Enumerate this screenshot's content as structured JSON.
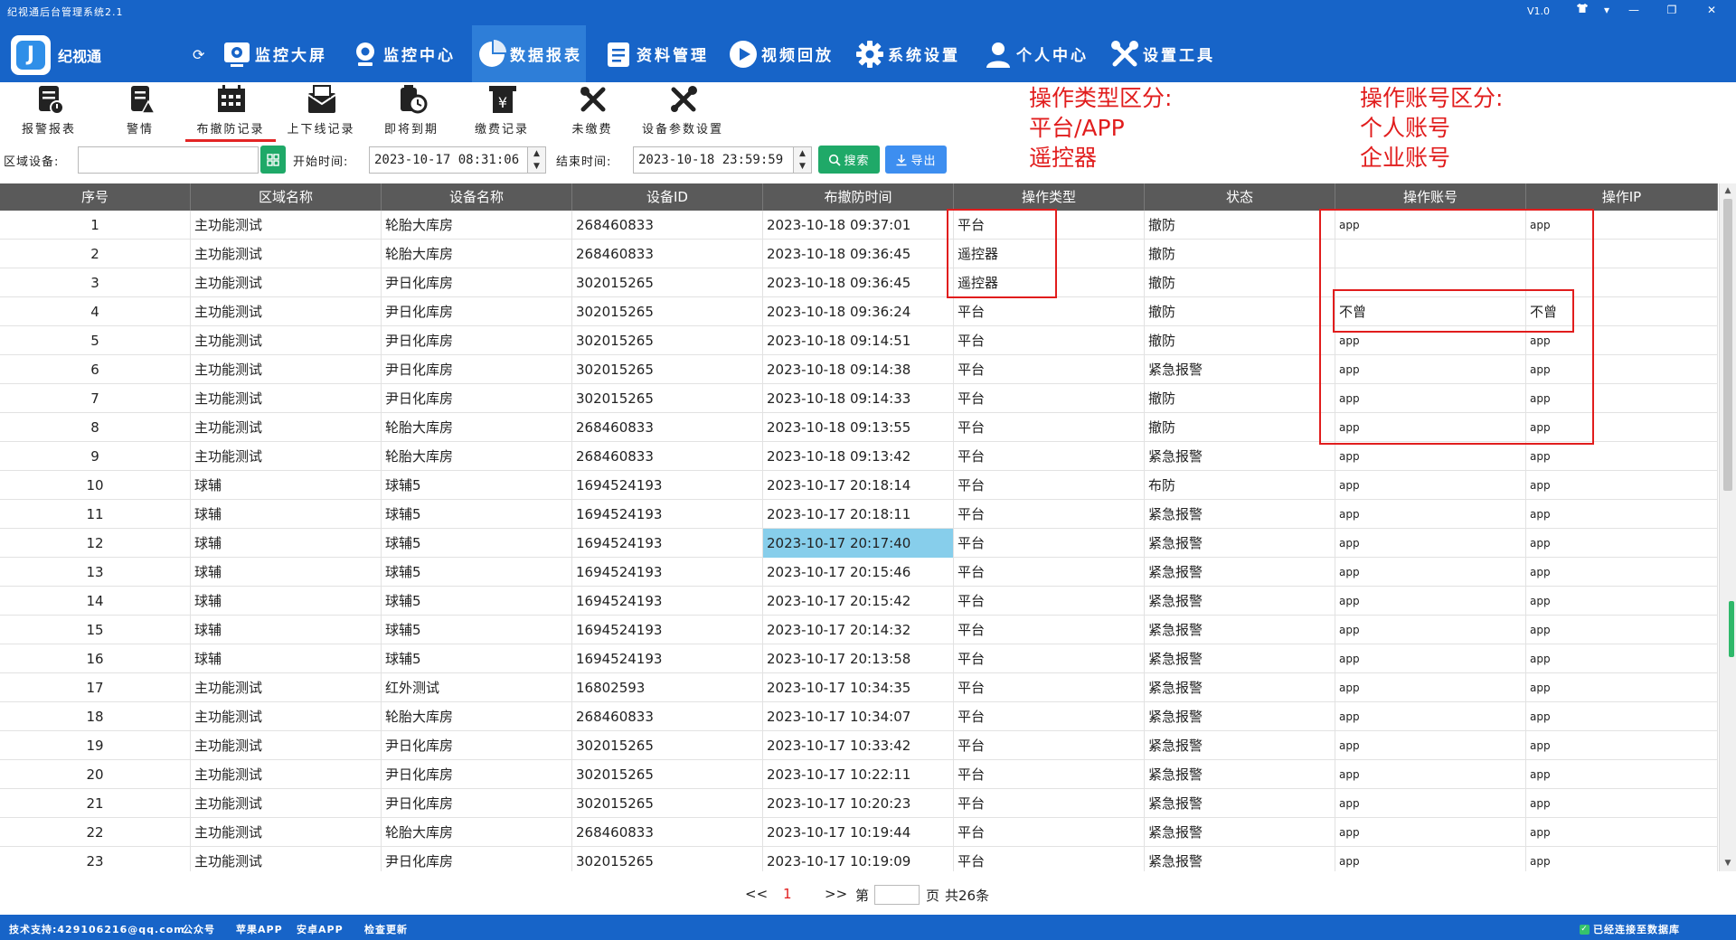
{
  "window": {
    "title": "纪视通后台管理系统2.1",
    "version": "V1.0"
  },
  "brand": {
    "logo_text": "纪视通"
  },
  "nav": {
    "items": [
      {
        "label": "监控大屏",
        "icon": "monitor-icon"
      },
      {
        "label": "监控中心",
        "icon": "camera-icon"
      },
      {
        "label": "数据报表",
        "icon": "pie-chart-icon"
      },
      {
        "label": "资料管理",
        "icon": "document-icon"
      },
      {
        "label": "视频回放",
        "icon": "play-icon"
      },
      {
        "label": "系统设置",
        "icon": "gear-icon"
      },
      {
        "label": "个人中心",
        "icon": "user-icon"
      },
      {
        "label": "设置工具",
        "icon": "tools-icon"
      }
    ],
    "active": "数据报表"
  },
  "toolbar": {
    "items": [
      {
        "label": "报警报表",
        "icon": "alarm-report-icon"
      },
      {
        "label": "警情",
        "icon": "alert-doc-icon"
      },
      {
        "label": "布撤防记录",
        "icon": "calendar-icon"
      },
      {
        "label": "上下线记录",
        "icon": "envelope-icon"
      },
      {
        "label": "即将到期",
        "icon": "clock-doc-icon"
      },
      {
        "label": "缴费记录",
        "icon": "payment-icon"
      },
      {
        "label": "未缴费",
        "icon": "unpaid-icon"
      },
      {
        "label": "设备参数设置",
        "icon": "device-settings-icon"
      }
    ],
    "active": "布撤防记录"
  },
  "filters": {
    "area_label": "区域设备:",
    "area_value": "",
    "start_label": "开始时间:",
    "start_value": "2023-10-17 08:31:06",
    "end_label": "结束时间:",
    "end_value": "2023-10-18 23:59:59",
    "search_label": "搜索",
    "export_label": "导出"
  },
  "annotations": {
    "op_type": [
      "操作类型区分:",
      "平台/APP",
      "遥控器"
    ],
    "op_account": [
      "操作账号区分:",
      "个人账号",
      "企业账号"
    ]
  },
  "table": {
    "headers": [
      "序号",
      "区域名称",
      "设备名称",
      "设备ID",
      "布撤防时间",
      "操作类型",
      "状态",
      "操作账号",
      "操作IP"
    ],
    "rows": [
      [
        "1",
        "主功能测试",
        "轮胎大库房",
        "268460833",
        "2023-10-18 09:37:01",
        "平台",
        "撤防",
        "app",
        "app"
      ],
      [
        "2",
        "主功能测试",
        "轮胎大库房",
        "268460833",
        "2023-10-18 09:36:45",
        "遥控器",
        "撤防",
        "",
        ""
      ],
      [
        "3",
        "主功能测试",
        "尹日化库房",
        "302015265",
        "2023-10-18 09:36:45",
        "遥控器",
        "撤防",
        "",
        ""
      ],
      [
        "4",
        "主功能测试",
        "尹日化库房",
        "302015265",
        "2023-10-18 09:36:24",
        "平台",
        "撤防",
        "不曾",
        "不曾"
      ],
      [
        "5",
        "主功能测试",
        "尹日化库房",
        "302015265",
        "2023-10-18 09:14:51",
        "平台",
        "撤防",
        "app",
        "app"
      ],
      [
        "6",
        "主功能测试",
        "尹日化库房",
        "302015265",
        "2023-10-18 09:14:38",
        "平台",
        "紧急报警",
        "app",
        "app"
      ],
      [
        "7",
        "主功能测试",
        "尹日化库房",
        "302015265",
        "2023-10-18 09:14:33",
        "平台",
        "撤防",
        "app",
        "app"
      ],
      [
        "8",
        "主功能测试",
        "轮胎大库房",
        "268460833",
        "2023-10-18 09:13:55",
        "平台",
        "撤防",
        "app",
        "app"
      ],
      [
        "9",
        "主功能测试",
        "轮胎大库房",
        "268460833",
        "2023-10-18 09:13:42",
        "平台",
        "紧急报警",
        "app",
        "app"
      ],
      [
        "10",
        "球辅",
        "球辅5",
        "1694524193",
        "2023-10-17 20:18:14",
        "平台",
        "布防",
        "app",
        "app"
      ],
      [
        "11",
        "球辅",
        "球辅5",
        "1694524193",
        "2023-10-17 20:18:11",
        "平台",
        "紧急报警",
        "app",
        "app"
      ],
      [
        "12",
        "球辅",
        "球辅5",
        "1694524193",
        "2023-10-17 20:17:40",
        "平台",
        "紧急报警",
        "app",
        "app"
      ],
      [
        "13",
        "球辅",
        "球辅5",
        "1694524193",
        "2023-10-17 20:15:46",
        "平台",
        "紧急报警",
        "app",
        "app"
      ],
      [
        "14",
        "球辅",
        "球辅5",
        "1694524193",
        "2023-10-17 20:15:42",
        "平台",
        "紧急报警",
        "app",
        "app"
      ],
      [
        "15",
        "球辅",
        "球辅5",
        "1694524193",
        "2023-10-17 20:14:32",
        "平台",
        "紧急报警",
        "app",
        "app"
      ],
      [
        "16",
        "球辅",
        "球辅5",
        "1694524193",
        "2023-10-17 20:13:58",
        "平台",
        "紧急报警",
        "app",
        "app"
      ],
      [
        "17",
        "主功能测试",
        "红外测试",
        "16802593",
        "2023-10-17 10:34:35",
        "平台",
        "紧急报警",
        "app",
        "app"
      ],
      [
        "18",
        "主功能测试",
        "轮胎大库房",
        "268460833",
        "2023-10-17 10:34:07",
        "平台",
        "紧急报警",
        "app",
        "app"
      ],
      [
        "19",
        "主功能测试",
        "尹日化库房",
        "302015265",
        "2023-10-17 10:33:42",
        "平台",
        "紧急报警",
        "app",
        "app"
      ],
      [
        "20",
        "主功能测试",
        "尹日化库房",
        "302015265",
        "2023-10-17 10:22:11",
        "平台",
        "紧急报警",
        "app",
        "app"
      ],
      [
        "21",
        "主功能测试",
        "尹日化库房",
        "302015265",
        "2023-10-17 10:20:23",
        "平台",
        "紧急报警",
        "app",
        "app"
      ],
      [
        "22",
        "主功能测试",
        "轮胎大库房",
        "268460833",
        "2023-10-17 10:19:44",
        "平台",
        "紧急报警",
        "app",
        "app"
      ],
      [
        "23",
        "主功能测试",
        "尹日化库房",
        "302015265",
        "2023-10-17 10:19:09",
        "平台",
        "紧急报警",
        "app",
        "app"
      ]
    ],
    "selected_row": 12
  },
  "pager": {
    "prev": "<<",
    "current": "1",
    "next": ">>",
    "page_prefix": "第",
    "page_suffix": "页",
    "total": "共26条"
  },
  "statusbar": {
    "support": "技术支持:429106216@qq.com",
    "wechat": "公众号",
    "ios_app": "苹果APP",
    "android_app": "安卓APP",
    "update": "检查更新",
    "db_status": "已经连接至数据库"
  },
  "colors": {
    "header_bg": "#1764c8",
    "accent_red": "#e11d1d",
    "table_header_bg": "#5a5a5a",
    "selected_cell": "#87ceeb",
    "search_green": "#1fa968",
    "export_blue": "#3d8ef0"
  }
}
